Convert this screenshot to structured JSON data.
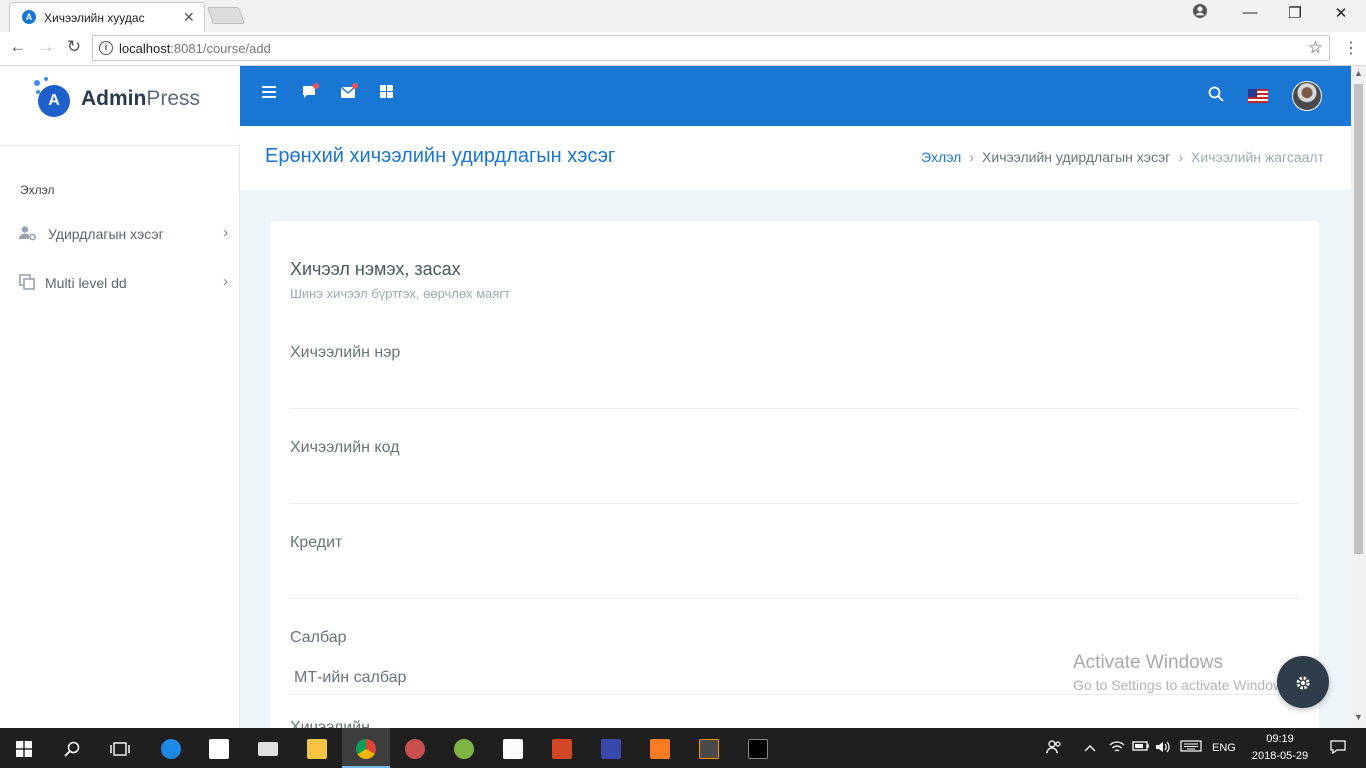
{
  "browser": {
    "tab_title": "Хичээлийн хуудас",
    "tab_favicon": "A",
    "tab_close": "✕",
    "url_host": "localhost",
    "url_path": ":8081/course/add",
    "window_controls": {
      "minimize": "—",
      "maximize": "❐",
      "close": "✕"
    },
    "nav": {
      "back": "←",
      "forward": "→",
      "reload": "↻"
    },
    "star": "☆",
    "menu": "⋮",
    "info": "i"
  },
  "app": {
    "logo_letter": "A",
    "logo_admin": "Admin",
    "logo_press": "Press",
    "sidebar": {
      "heading": "Эхлэл",
      "items": [
        {
          "label": "Удирдлагын хэсэг",
          "icon": "users-cog-icon",
          "chevron": "›"
        },
        {
          "label": "Multi level dd",
          "icon": "copy-icon",
          "chevron": "›"
        }
      ]
    },
    "topbar": {
      "icons": [
        "hamburger-menu-icon",
        "chat-icon",
        "mail-icon",
        "grid-icon",
        "search-icon",
        "us-flag-icon",
        "avatar"
      ]
    },
    "page_title": "Ерөнхий хичээлийн удирдлагын хэсэг",
    "breadcrumb": {
      "home": "Эхлэл",
      "section": "Хичээлийн удирдлагын хэсэг",
      "current": "Хичээлийн жагсаалт",
      "separator": "›"
    },
    "form": {
      "title": "Хичээл нэмэх, засах",
      "subtitle": "Шинэ хичээл бүртгэх, өөрчлөх маягт",
      "fields": [
        {
          "label": "Хичээлийн нэр",
          "value": ""
        },
        {
          "label": "Хичээлийн код",
          "value": ""
        },
        {
          "label": "Кредит",
          "value": ""
        }
      ],
      "select_label": "Салбар",
      "select_value": "МТ-ийн салбар",
      "next_label": "Хичээлийн"
    }
  },
  "watermark": {
    "line1": "Activate Windows",
    "line2": "Go to Settings to activate Windows."
  },
  "taskbar": {
    "language": "ENG",
    "time": "09:19",
    "date": "2018-05-29",
    "colors": {
      "background": "#1f1f1f",
      "accent": "#1976d2"
    }
  }
}
